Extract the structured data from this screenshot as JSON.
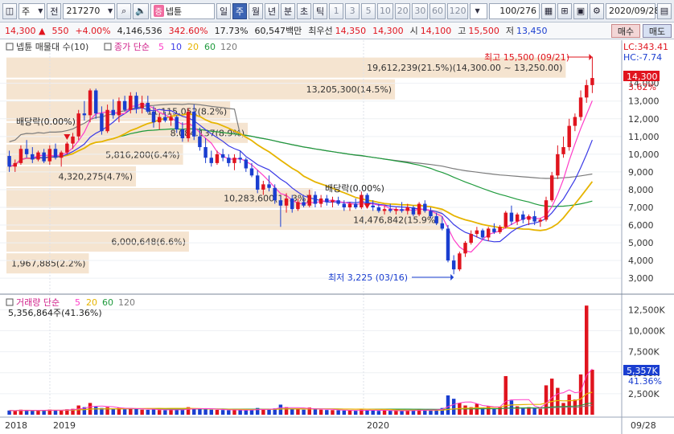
{
  "toolbar": {
    "market_select": "주",
    "type_button": "전",
    "code_value": "217270",
    "stock_tag": "증",
    "stock_name": "넵튠",
    "period_buttons": [
      "일",
      "주",
      "월",
      "년",
      "분",
      "초",
      "틱"
    ],
    "active_period": "주",
    "interval_buttons": [
      "1",
      "3",
      "5",
      "10",
      "20",
      "30",
      "60",
      "120"
    ],
    "count_value": "100",
    "count_total": "/276",
    "date_value": "2020/09/28"
  },
  "quote": {
    "price": "14,300",
    "change": "550",
    "change_pct": "+4.00%",
    "volume": "4,146,536",
    "volume_ratio": "342.60%",
    "turnover": "17.73%",
    "amount": "60,547백만",
    "best_label": "최우선",
    "best_ask": "14,350",
    "best_bid": "14,300",
    "open_label": "시",
    "open": "14,100",
    "high_label": "고",
    "high": "15,500",
    "low_label": "저",
    "low": "13,450",
    "buy_label": "매수",
    "sell_label": "매도"
  },
  "price_panel": {
    "legend_volume_profile": "넵튠 매물대 수(10)",
    "legend_ma_title": "종가 단순",
    "ma_periods": [
      "5",
      "10",
      "20",
      "60",
      "120"
    ],
    "lc_label": "LC:343.41",
    "hc_label": "HC:-7.74",
    "current_price_label": "14,300",
    "current_pct_label": "3.62%",
    "high_annotation": "최고 15,500 (09/21)",
    "low_annotation": "최저 3,225 (03/16)",
    "dividend_label_1": "배당락(0.00%)",
    "dividend_label_2": "배당락(0.00%)",
    "y_ticks": [
      "14,000",
      "13,000",
      "12,000",
      "11,000",
      "10,000",
      "9,000",
      "8,000",
      "7,000",
      "6,000",
      "5,000",
      "4,000",
      "3,000"
    ],
    "profile_labels": [
      "19,612,239(21.5%)(14,300.00 ~ 13,250.00)",
      "13,205,300(14.5%)",
      "11,115,052(8.2%)",
      "8,084,137(8.9%)",
      "5,816,200(6.4%)",
      "4,320,275(4.7%)",
      "10,283,600(11.3%)",
      "14,476,842(15.9%)",
      "6,000,648(6.6%)",
      "1,967,885(2.2%)"
    ]
  },
  "volume_panel": {
    "legend_title": "거래량 단순",
    "ma_periods": [
      "5",
      "20",
      "60",
      "120"
    ],
    "current_volume": "5,356,864주(41.36%)",
    "y_ticks": [
      "12,500K",
      "10,000K",
      "7,500K",
      "5,000K",
      "2,500K"
    ],
    "current_label": "5,357K",
    "current_pct": "41.36%"
  },
  "x_axis": {
    "labels": [
      "2018",
      "2019",
      "2020"
    ],
    "end_label": "09/28"
  },
  "colors": {
    "up": "#e0141e",
    "down": "#1a3ed0",
    "ma5": "#ff3cc8",
    "ma10": "#3a3ae6",
    "ma20": "#e6b400",
    "ma60": "#1e9a3c",
    "ma120": "#7a7a7a",
    "profile": "#f5e4d0"
  },
  "chart_data": {
    "type": "candlestick",
    "price_range": [
      2600,
      15800
    ],
    "bars": [
      [
        9900,
        10200,
        9000,
        9300
      ],
      [
        9300,
        9700,
        9000,
        9500
      ],
      [
        9500,
        10500,
        9400,
        10300
      ],
      [
        10300,
        10800,
        9800,
        10000
      ],
      [
        10000,
        10400,
        9500,
        9700
      ],
      [
        9700,
        10200,
        9600,
        10100
      ],
      [
        10100,
        10300,
        9500,
        9600
      ],
      [
        9600,
        10500,
        9400,
        10300
      ],
      [
        10300,
        10600,
        9700,
        9800
      ],
      [
        9800,
        10200,
        9300,
        10100
      ],
      [
        10100,
        10700,
        10000,
        10600
      ],
      [
        10600,
        11200,
        10300,
        11000
      ],
      [
        11000,
        12500,
        10800,
        12300
      ],
      [
        12300,
        13000,
        11900,
        12200
      ],
      [
        12200,
        13700,
        11800,
        13600
      ],
      [
        13600,
        13700,
        12000,
        12300
      ],
      [
        12300,
        12700,
        11100,
        11300
      ],
      [
        11300,
        12800,
        11200,
        12500
      ],
      [
        12500,
        13100,
        12000,
        12200
      ],
      [
        12200,
        13200,
        11800,
        13000
      ],
      [
        13000,
        13300,
        12400,
        12500
      ],
      [
        12500,
        13500,
        12300,
        13300
      ],
      [
        13300,
        13500,
        12300,
        12600
      ],
      [
        12600,
        13300,
        12300,
        12900
      ],
      [
        12900,
        13300,
        12300,
        12400
      ],
      [
        12400,
        12700,
        11500,
        11800
      ],
      [
        11800,
        12300,
        11400,
        12100
      ],
      [
        12100,
        12400,
        11800,
        11900
      ],
      [
        11900,
        12300,
        11600,
        12100
      ],
      [
        12100,
        12200,
        11200,
        11400
      ],
      [
        11400,
        11800,
        10700,
        10900
      ],
      [
        10900,
        12600,
        10700,
        12400
      ],
      [
        12400,
        12800,
        10800,
        11000
      ],
      [
        11000,
        11500,
        10200,
        10400
      ],
      [
        10400,
        10900,
        9500,
        9800
      ],
      [
        9800,
        10200,
        9300,
        9500
      ],
      [
        9500,
        10200,
        9400,
        10000
      ],
      [
        10000,
        10300,
        9600,
        9800
      ],
      [
        9800,
        10000,
        9300,
        9500
      ],
      [
        9500,
        10000,
        9100,
        9800
      ],
      [
        9800,
        10200,
        9500,
        9700
      ],
      [
        9700,
        9800,
        9000,
        9200
      ],
      [
        9200,
        9500,
        8700,
        8800
      ],
      [
        8800,
        9100,
        7800,
        8000
      ],
      [
        8000,
        8500,
        7700,
        8300
      ],
      [
        8300,
        8800,
        7900,
        8100
      ],
      [
        8100,
        8300,
        7200,
        7400
      ],
      [
        7400,
        7600,
        5900,
        7100
      ],
      [
        7100,
        7800,
        6700,
        7500
      ],
      [
        7500,
        7700,
        6700,
        6900
      ],
      [
        6900,
        7500,
        6800,
        7300
      ],
      [
        7300,
        7600,
        7000,
        7100
      ],
      [
        7100,
        8000,
        7000,
        7700
      ],
      [
        7700,
        7900,
        7000,
        7200
      ],
      [
        7200,
        7700,
        7000,
        7500
      ],
      [
        7500,
        7700,
        7100,
        7300
      ],
      [
        7300,
        7600,
        7000,
        7400
      ],
      [
        7400,
        7600,
        7100,
        7200
      ],
      [
        7200,
        7400,
        6800,
        7000
      ],
      [
        7000,
        7300,
        6800,
        7200
      ],
      [
        7200,
        7500,
        6900,
        7000
      ],
      [
        7000,
        7900,
        6900,
        7700
      ],
      [
        7700,
        7800,
        7000,
        7100
      ],
      [
        7100,
        7400,
        6800,
        7000
      ],
      [
        7000,
        7200,
        6700,
        6800
      ],
      [
        6800,
        7100,
        6600,
        6900
      ],
      [
        6900,
        7200,
        6700,
        6800
      ],
      [
        6800,
        7000,
        6600,
        6900
      ],
      [
        6900,
        7300,
        6700,
        6800
      ],
      [
        6800,
        7200,
        6600,
        7000
      ],
      [
        7000,
        7100,
        6500,
        6600
      ],
      [
        6600,
        7300,
        6500,
        7200
      ],
      [
        7200,
        7400,
        6700,
        6800
      ],
      [
        6800,
        7000,
        6400,
        6500
      ],
      [
        6500,
        6700,
        6000,
        6100
      ],
      [
        6100,
        6500,
        5700,
        5800
      ],
      [
        5800,
        6000,
        3900,
        4000
      ],
      [
        4000,
        4300,
        3225,
        3500
      ],
      [
        3500,
        4500,
        3400,
        4400
      ],
      [
        4400,
        5100,
        4200,
        5000
      ],
      [
        5000,
        5700,
        4900,
        5500
      ],
      [
        5500,
        5900,
        5300,
        5700
      ],
      [
        5700,
        5800,
        5200,
        5300
      ],
      [
        5300,
        5900,
        5100,
        5800
      ],
      [
        5800,
        6100,
        5500,
        5600
      ],
      [
        5600,
        6000,
        5500,
        5900
      ],
      [
        5900,
        6800,
        5800,
        6700
      ],
      [
        6700,
        7100,
        6000,
        6200
      ],
      [
        6200,
        6700,
        6000,
        6600
      ],
      [
        6600,
        6800,
        6100,
        6300
      ],
      [
        6300,
        6600,
        6000,
        6500
      ],
      [
        6500,
        6800,
        6000,
        6200
      ],
      [
        6200,
        6400,
        5900,
        6300
      ],
      [
        6300,
        7600,
        6200,
        7400
      ],
      [
        7400,
        9000,
        7300,
        8800
      ],
      [
        8800,
        10500,
        8600,
        10000
      ],
      [
        10000,
        11000,
        9800,
        10400
      ],
      [
        10400,
        12000,
        10200,
        11600
      ],
      [
        11600,
        12300,
        11300,
        12100
      ],
      [
        12100,
        13600,
        11900,
        13200
      ],
      [
        13200,
        14200,
        12900,
        13900
      ],
      [
        13900,
        15500,
        13450,
        14300
      ]
    ],
    "volume_range": [
      0,
      13500
    ],
    "volumes": [
      500,
      450,
      600,
      550,
      500,
      480,
      520,
      610,
      550,
      500,
      650,
      700,
      1100,
      900,
      1400,
      950,
      800,
      900,
      700,
      820,
      650,
      780,
      700,
      600,
      580,
      620,
      560,
      540,
      600,
      580,
      620,
      900,
      760,
      700,
      650,
      600,
      580,
      560,
      540,
      600,
      560,
      520,
      600,
      800,
      700,
      650,
      750,
      1200,
      900,
      650,
      700,
      600,
      850,
      640,
      600,
      560,
      550,
      520,
      500,
      480,
      470,
      620,
      560,
      500,
      460,
      480,
      470,
      460,
      480,
      500,
      520,
      640,
      560,
      540,
      600,
      800,
      2300,
      1900,
      1400,
      1100,
      900,
      1300,
      800,
      1000,
      700,
      900,
      4600,
      1700,
      1000,
      800,
      900,
      800,
      700,
      3500,
      4300,
      3200,
      1400,
      2400,
      1800,
      4800,
      13000,
      5357
    ]
  }
}
